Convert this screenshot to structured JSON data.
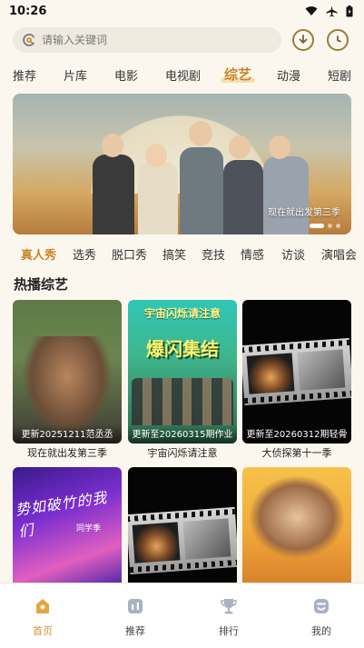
{
  "status_bar": {
    "time": "10:26"
  },
  "search": {
    "placeholder": "请输入关键词"
  },
  "categories": [
    "推荐",
    "片库",
    "电影",
    "电视剧",
    "综艺",
    "动漫",
    "短剧"
  ],
  "active_category": "综艺",
  "banner": {
    "caption": "现在就出发第三季"
  },
  "sub_tabs": [
    "真人秀",
    "选秀",
    "脱口秀",
    "搞笑",
    "竞技",
    "情感",
    "访谈",
    "演唱会"
  ],
  "active_sub_tab": "真人秀",
  "section_title": "热播综艺",
  "cards": [
    {
      "update": "更新20251211范丞丞",
      "title": "现在就出发第三季"
    },
    {
      "update": "更新至20260315期作业",
      "title": "宇宙闪烁请注意",
      "poster_text": "宇宙闪烁请注意",
      "poster_text2": "爆闪集结"
    },
    {
      "update": "更新至20260312期轻骨",
      "title": "大侦探第十一季"
    },
    {
      "update": "",
      "title": "",
      "poster_text": "势如破竹的我们",
      "poster_sub": "同学季"
    },
    {
      "update": "",
      "title": ""
    },
    {
      "update": "",
      "title": ""
    }
  ],
  "bottom_nav": [
    {
      "label": "首页",
      "icon": "home-icon"
    },
    {
      "label": "推荐",
      "icon": "recommend-icon"
    },
    {
      "label": "排行",
      "icon": "trophy-icon"
    },
    {
      "label": "我的",
      "icon": "profile-icon"
    }
  ],
  "colors": {
    "accent": "#d39335",
    "background": "#fbf7ef"
  }
}
